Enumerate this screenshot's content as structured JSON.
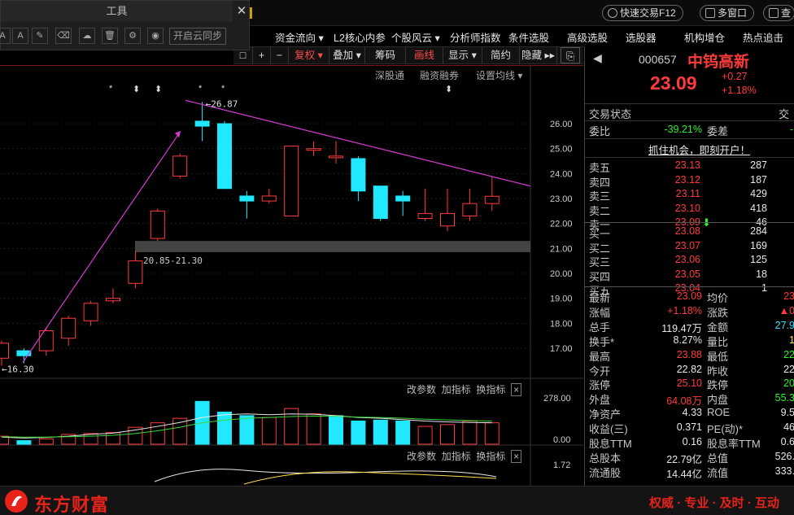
{
  "topbar": {
    "quick_trade": "快速交易F12",
    "multi_window": "多窗口",
    "query": "查"
  },
  "tool_window": {
    "title": "工具",
    "buttons": [
      "A",
      "A",
      "✎",
      "⌫",
      "☁",
      "🗑",
      "⚙",
      "◉",
      "⧉"
    ],
    "cloud_sync": "开启云同步"
  },
  "menu": [
    "资金流向",
    "L2核心内参",
    "个股风云",
    "分析师指数",
    "条件选股",
    "高级选股",
    "选股器",
    "机构增仓",
    "热点追击"
  ],
  "toolbar": {
    "items": [
      "复权",
      "叠加",
      "筹码",
      "画线",
      "显示",
      "简约",
      "隐藏"
    ],
    "tools": [
      "□",
      "+",
      "−"
    ]
  },
  "chart_sublinks": [
    "深股通",
    "融资融券",
    "设置均线"
  ],
  "chart_data": {
    "type": "candlestick",
    "ylim": [
      16,
      26.6
    ],
    "y_ticks": [
      "26.00",
      "25.00",
      "24.00",
      "23.00",
      "22.00",
      "21.00",
      "20.00",
      "19.00",
      "18.00",
      "17.00"
    ],
    "candles": [
      {
        "o": 16.6,
        "c": 17.2,
        "h": 17.3,
        "l": 16.3
      },
      {
        "o": 16.9,
        "c": 16.7,
        "h": 17.0,
        "l": 16.4
      },
      {
        "o": 16.9,
        "c": 17.7,
        "h": 17.8,
        "l": 16.7
      },
      {
        "o": 17.4,
        "c": 18.2,
        "h": 18.3,
        "l": 17.1
      },
      {
        "o": 18.1,
        "c": 18.8,
        "h": 18.9,
        "l": 17.9
      },
      {
        "o": 18.9,
        "c": 19.0,
        "h": 19.4,
        "l": 18.8
      },
      {
        "o": 19.6,
        "c": 20.5,
        "h": 20.9,
        "l": 19.4
      },
      {
        "o": 21.4,
        "c": 22.5,
        "h": 22.6,
        "l": 21.3
      },
      {
        "o": 23.9,
        "c": 24.7,
        "h": 24.8,
        "l": 23.8
      },
      {
        "o": 26.1,
        "c": 25.9,
        "h": 26.87,
        "l": 25.3
      },
      {
        "o": 26.0,
        "c": 23.4,
        "h": 26.1,
        "l": 23.4
      },
      {
        "o": 23.1,
        "c": 22.9,
        "h": 23.3,
        "l": 22.2
      },
      {
        "o": 22.9,
        "c": 23.1,
        "h": 23.4,
        "l": 22.8
      },
      {
        "o": 22.3,
        "c": 25.1,
        "h": 25.1,
        "l": 22.3
      },
      {
        "o": 25.0,
        "c": 25.0,
        "h": 25.3,
        "l": 24.7
      },
      {
        "o": 24.7,
        "c": 24.7,
        "h": 25.3,
        "l": 24.4
      },
      {
        "o": 24.6,
        "c": 23.3,
        "h": 24.7,
        "l": 22.9
      },
      {
        "o": 23.5,
        "c": 22.2,
        "h": 23.5,
        "l": 22.1
      },
      {
        "o": 23.1,
        "c": 22.9,
        "h": 23.3,
        "l": 22.3
      },
      {
        "o": 22.2,
        "c": 22.4,
        "h": 23.4,
        "l": 22.1
      },
      {
        "o": 21.9,
        "c": 22.4,
        "h": 23.4,
        "l": 21.7
      },
      {
        "o": 22.3,
        "c": 22.8,
        "h": 23.4,
        "l": 22.1
      },
      {
        "o": 22.8,
        "c": 23.09,
        "h": 23.88,
        "l": 22.5
      }
    ],
    "annotations": {
      "high": "←26.87",
      "low": "←16.30",
      "zone": "20.85-21.30"
    },
    "markers": [
      "*",
      "⬍",
      "⬍",
      "*",
      "*",
      "⬍"
    ],
    "volume_label": "278.00",
    "volume_zero": "0.00",
    "volume": [
      45,
      20,
      30,
      55,
      60,
      65,
      95,
      120,
      145,
      240,
      180,
      160,
      150,
      200,
      170,
      160,
      130,
      135,
      130,
      100,
      110,
      130,
      120
    ],
    "volume_up": [
      true,
      false,
      true,
      true,
      true,
      true,
      true,
      true,
      true,
      false,
      false,
      false,
      true,
      true,
      true,
      false,
      false,
      false,
      false,
      true,
      true,
      true,
      true
    ],
    "volume_ma5": [
      40,
      35,
      38,
      45,
      55,
      62,
      80,
      100,
      122,
      150,
      165,
      170,
      165,
      170,
      168,
      160,
      150,
      145,
      138,
      130,
      125,
      122,
      120
    ],
    "volume_ma10": [
      42,
      40,
      40,
      42,
      45,
      50,
      60,
      75,
      95,
      120,
      135,
      145,
      150,
      155,
      158,
      156,
      152,
      150,
      146,
      140,
      136,
      132,
      130
    ],
    "macd_label": "1.72"
  },
  "indicator_bar": [
    "改参数",
    "加指标",
    "换指标",
    "×"
  ],
  "stock": {
    "code": "000657",
    "name": "中钨高新",
    "price": "23.09",
    "change": "+0.27",
    "change_pct": "+1.18%"
  },
  "trade_status": {
    "label": "交易状态",
    "extra": "交"
  },
  "wei": {
    "label1": "委比",
    "value1": "-39.21%",
    "label2": "委差",
    "value2": "-"
  },
  "banner": "抓住机会，即刻开户！",
  "order_book": {
    "sells": [
      {
        "label": "卖五",
        "price": "23.13",
        "vol": "287"
      },
      {
        "label": "卖四",
        "price": "23.12",
        "vol": "187"
      },
      {
        "label": "卖三",
        "price": "23.11",
        "vol": "429"
      },
      {
        "label": "卖二",
        "price": "23.10",
        "vol": "418"
      },
      {
        "label": "卖一",
        "price": "23.09",
        "vol": "46"
      }
    ],
    "buys": [
      {
        "label": "买一",
        "price": "23.08",
        "vol": "284"
      },
      {
        "label": "买二",
        "price": "23.07",
        "vol": "169"
      },
      {
        "label": "买三",
        "price": "23.06",
        "vol": "125"
      },
      {
        "label": "买四",
        "price": "23.05",
        "vol": "18"
      },
      {
        "label": "买五",
        "price": "23.04",
        "vol": "1"
      }
    ]
  },
  "stats": [
    {
      "l1": "最新",
      "v1": "23.09",
      "c1": "red",
      "l2": "均价",
      "v2": "23",
      "c2": "red"
    },
    {
      "l1": "涨幅",
      "v1": "+1.18%",
      "c1": "red",
      "l2": "涨跌",
      "v2": "▲0",
      "c2": "red"
    },
    {
      "l1": "总手",
      "v1": "119.47万",
      "c1": "white",
      "l2": "金额",
      "v2": "27.9",
      "c2": "cyan"
    },
    {
      "l1": "换手*",
      "v1": "8.27%",
      "c1": "white",
      "l2": "量比",
      "v2": "1",
      "c2": "yellow"
    },
    {
      "l1": "最高",
      "v1": "23.88",
      "c1": "red",
      "l2": "最低",
      "v2": "22",
      "c2": "green"
    },
    {
      "l1": "今开",
      "v1": "22.82",
      "c1": "white",
      "l2": "昨收",
      "v2": "22",
      "c2": "white"
    },
    {
      "l1": "涨停",
      "v1": "25.10",
      "c1": "red",
      "l2": "跌停",
      "v2": "20",
      "c2": "green"
    },
    {
      "l1": "外盘",
      "v1": "64.08万",
      "c1": "red",
      "l2": "内盘",
      "v2": "55.3",
      "c2": "green"
    },
    {
      "l1": "净资产",
      "v1": "4.33",
      "c1": "white",
      "l2": "ROE",
      "v2": "9.5",
      "c2": "white"
    },
    {
      "l1": "收益(三)",
      "v1": "0.371",
      "c1": "white",
      "l2": "PE(动)*",
      "v2": "46",
      "c2": "white"
    },
    {
      "l1": "股息TTM",
      "v1": "0.16",
      "c1": "white",
      "l2": "股息率TTM",
      "v2": "0.6",
      "c2": "white"
    },
    {
      "l1": "总股本",
      "v1": "22.79亿",
      "c1": "white",
      "l2": "总值",
      "v2": "526.",
      "c2": "white"
    },
    {
      "l1": "流通股",
      "v1": "14.44亿",
      "c1": "white",
      "l2": "流值",
      "v2": "333.",
      "c2": "white"
    }
  ],
  "footer": {
    "logo": "东方财富",
    "slogan": "权威 · 专业 · 及时 · 互动"
  },
  "colors": {
    "up": "#ff3b3b",
    "down": "#20e8ff",
    "trend": "#d43bd4",
    "grid": "#1e1e1e"
  }
}
